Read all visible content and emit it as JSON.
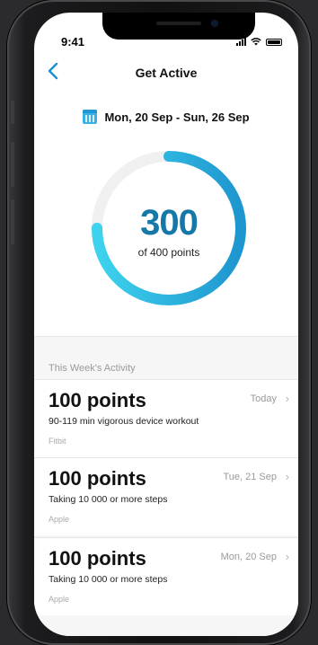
{
  "status_bar": {
    "time": "9:41"
  },
  "nav": {
    "title": "Get Active"
  },
  "date_range": "Mon, 20 Sep - Sun, 26 Sep",
  "progress": {
    "value": "300",
    "subtitle": "of 400 points",
    "fraction": 0.75
  },
  "colors": {
    "accent": "#1a8fd4",
    "ring_start": "#3dd3ee",
    "ring_end": "#1e95cf",
    "ring_track": "#f0f0f0"
  },
  "activity": {
    "heading": "This Week's Activity",
    "items": [
      {
        "points": "100 points",
        "description": "90-119 min vigorous device workout",
        "source": "Fitbit",
        "date": "Today"
      },
      {
        "points": "100 points",
        "description": "Taking 10 000 or more steps",
        "source": "Apple",
        "date": "Tue, 21 Sep"
      },
      {
        "points": "100 points",
        "description": "Taking 10 000 or more steps",
        "source": "Apple",
        "date": "Mon, 20 Sep"
      }
    ]
  }
}
